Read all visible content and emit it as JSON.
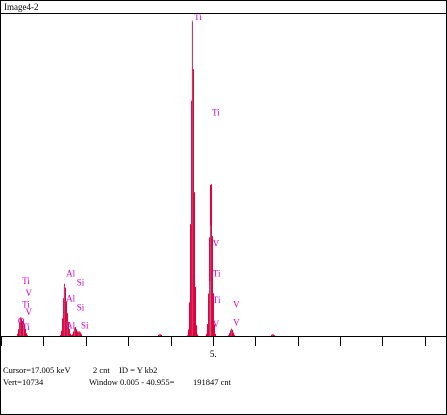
{
  "window": {
    "title": "Image4-2"
  },
  "axis": {
    "tick_label": "5."
  },
  "status": {
    "cursor": "Cursor=17.005 keV",
    "counts": "2 cnt",
    "id": "ID = Y kb2",
    "vert": "Vert=10734",
    "window": "Window 0.005 - 40.955=",
    "total": "191847 cnt"
  },
  "colors": {
    "spectrum": "#e8003a",
    "label": "#cc00cc",
    "axis": "#000000"
  },
  "chart_data": {
    "type": "area",
    "xlabel": "",
    "ylabel": "",
    "xlim": [
      0,
      10.5
    ],
    "ylim": [
      0,
      10734
    ],
    "xticks": [
      5
    ],
    "peaks": [
      {
        "x": 0.45,
        "y": 600
      },
      {
        "x": 0.53,
        "y": 400
      },
      {
        "x": 1.49,
        "y": 1700
      },
      {
        "x": 1.56,
        "y": 500
      },
      {
        "x": 1.74,
        "y": 300
      },
      {
        "x": 1.84,
        "y": 150
      },
      {
        "x": 4.51,
        "y": 10600
      },
      {
        "x": 4.93,
        "y": 1850
      },
      {
        "x": 4.95,
        "y": 3700
      },
      {
        "x": 5.43,
        "y": 250
      },
      {
        "x": 3.74,
        "y": 60
      },
      {
        "x": 6.4,
        "y": 60
      }
    ],
    "labels": [
      {
        "text": "Ti",
        "x": 4.51,
        "y": 10600
      },
      {
        "text": "Ti",
        "x": 4.93,
        "y": 7400
      },
      {
        "text": "V",
        "x": 4.95,
        "y": 3000
      },
      {
        "text": "Ti",
        "x": 4.95,
        "y": 2000
      },
      {
        "text": "Ti",
        "x": 4.95,
        "y": 1100
      },
      {
        "text": "V",
        "x": 4.95,
        "y": 300
      },
      {
        "text": "V",
        "x": 5.43,
        "y": 950
      },
      {
        "text": "V",
        "x": 5.43,
        "y": 350
      },
      {
        "text": "Al",
        "x": 1.49,
        "y": 2000
      },
      {
        "text": "Si",
        "x": 1.74,
        "y": 1700
      },
      {
        "text": "Al",
        "x": 1.49,
        "y": 1150
      },
      {
        "text": "Si",
        "x": 1.74,
        "y": 850
      },
      {
        "text": "Al",
        "x": 1.49,
        "y": 250
      },
      {
        "text": "Si",
        "x": 1.84,
        "y": 250
      },
      {
        "text": "Ti",
        "x": 0.45,
        "y": 1750
      },
      {
        "text": "V",
        "x": 0.53,
        "y": 1350
      },
      {
        "text": "Ti",
        "x": 0.45,
        "y": 950
      },
      {
        "text": "V",
        "x": 0.53,
        "y": 700
      },
      {
        "text": "O",
        "x": 0.35,
        "y": 400
      },
      {
        "text": "Ti",
        "x": 0.45,
        "y": 200
      }
    ]
  }
}
